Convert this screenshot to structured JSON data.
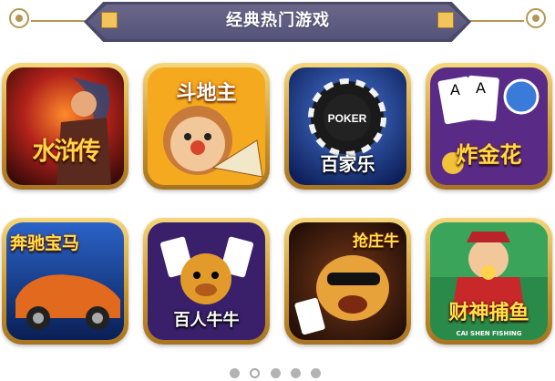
{
  "header": {
    "title": "经典热门游戏"
  },
  "games": [
    {
      "name": "水浒传",
      "subtitle": ""
    },
    {
      "name": "斗地主",
      "subtitle": ""
    },
    {
      "name": "百家乐",
      "subtitle": "POKER"
    },
    {
      "name": "炸金花",
      "subtitle": ""
    },
    {
      "name": "奔驰宝马",
      "subtitle": ""
    },
    {
      "name": "百人牛牛",
      "subtitle": ""
    },
    {
      "name": "抢庄牛",
      "subtitle": ""
    },
    {
      "name": "财神捕鱼",
      "subtitle": "CAI SHEN FISHING"
    }
  ],
  "pagination": {
    "total": 5,
    "active_index": 1
  },
  "colors": {
    "banner": "#4b4968",
    "accent_gold": "#f2c55c",
    "frame_gold": "#c7952e"
  }
}
